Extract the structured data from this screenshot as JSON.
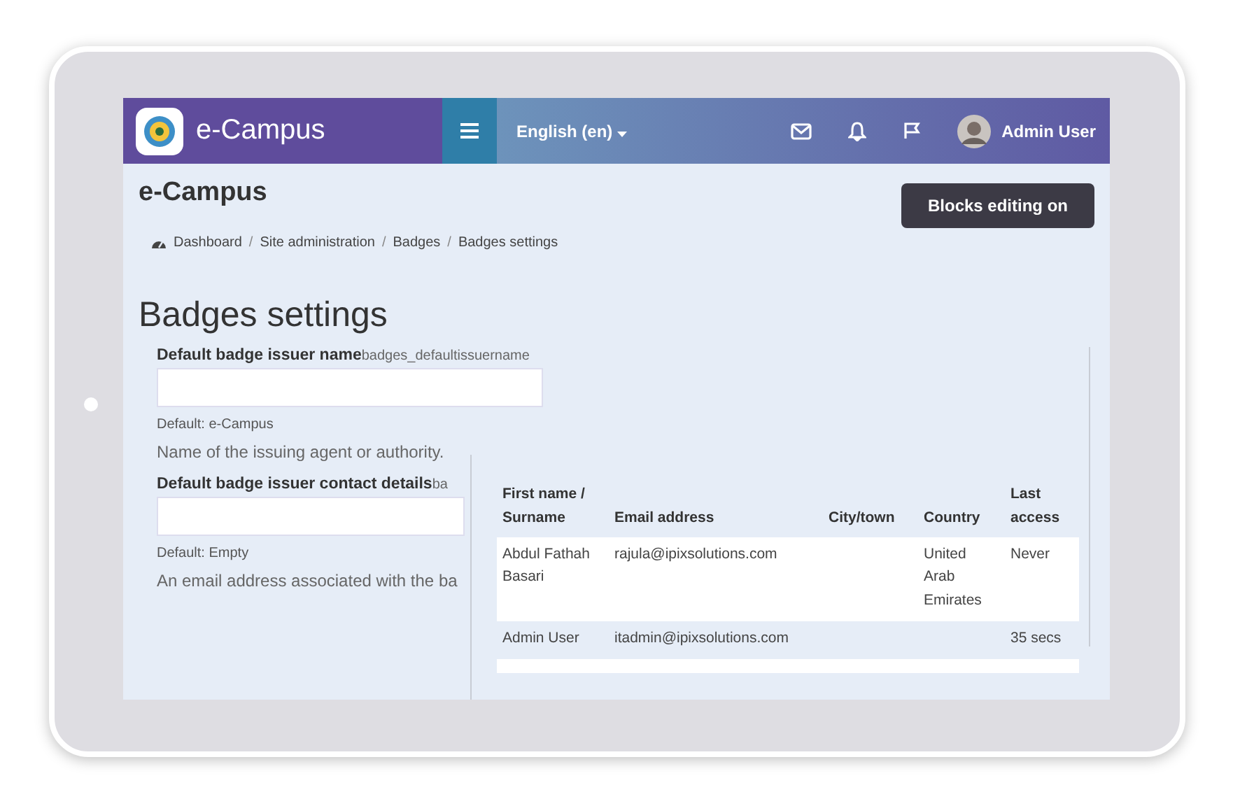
{
  "navbar": {
    "site_name": "e-Campus",
    "language": "English (en)",
    "user_name": "Admin User"
  },
  "page_header": {
    "title": "e-Campus",
    "edit_button": "Blocks editing on"
  },
  "breadcrumb": [
    "Dashboard",
    "Site administration",
    "Badges",
    "Badges settings"
  ],
  "breadcrumb_separator": "/",
  "heading": "Badges settings",
  "settings": [
    {
      "label": "Default badge issuer name",
      "setting_name": "badges_defaultissuername",
      "default": "Default: e-Campus",
      "description": "Name of the issuing agent or authority."
    },
    {
      "label": "Default badge issuer contact details",
      "setting_name": "ba",
      "default": "Default: Empty",
      "description": "An email address associated with the ba"
    }
  ],
  "user_table": {
    "columns": [
      "First name / Surname",
      "Email address",
      "City/town",
      "Country",
      "Last access"
    ],
    "rows": [
      [
        "Abdul Fathah Basari",
        "rajula@ipixsolutions.com",
        "",
        "United Arab Emirates",
        "Never"
      ],
      [
        "Admin User",
        "itadmin@ipixsolutions.com",
        "",
        "",
        "35 secs"
      ]
    ]
  }
}
